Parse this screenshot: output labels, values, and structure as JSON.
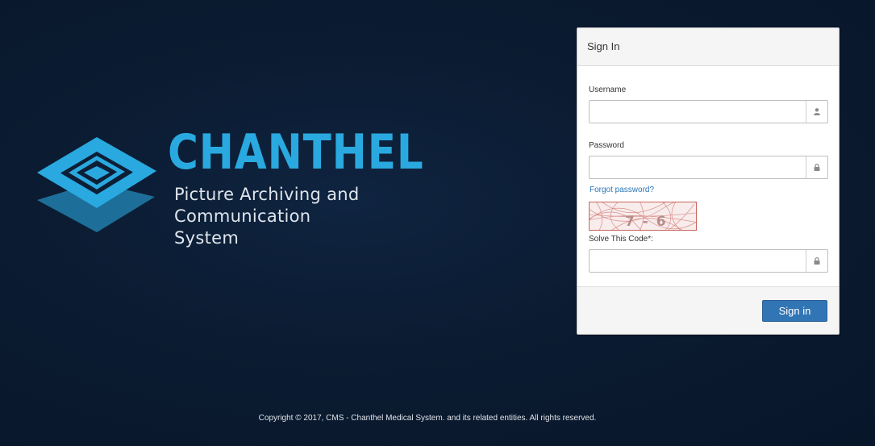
{
  "brand": {
    "name": "CHANTHEL",
    "tagline_lines": [
      "Picture Archiving and",
      "Communication",
      "System"
    ],
    "logo_icon": "layered-diamond-logo",
    "accent_color": "#29a9df"
  },
  "signin": {
    "title": "Sign In",
    "username_label": "Username",
    "username_value": "",
    "username_icon": "user-icon",
    "password_label": "Password",
    "password_value": "",
    "password_icon": "lock-icon",
    "forgot_link": "Forgot password?",
    "captcha_text": "7 - 6",
    "captcha_label": "Solve This Code*:",
    "captcha_value": "",
    "captcha_icon": "lock-icon",
    "submit_label": "Sign in",
    "submit_color": "#3175b5"
  },
  "footer": {
    "copyright": "Copyright © 2017, CMS - Chanthel Medical System. and its related entities. All rights reserved."
  }
}
